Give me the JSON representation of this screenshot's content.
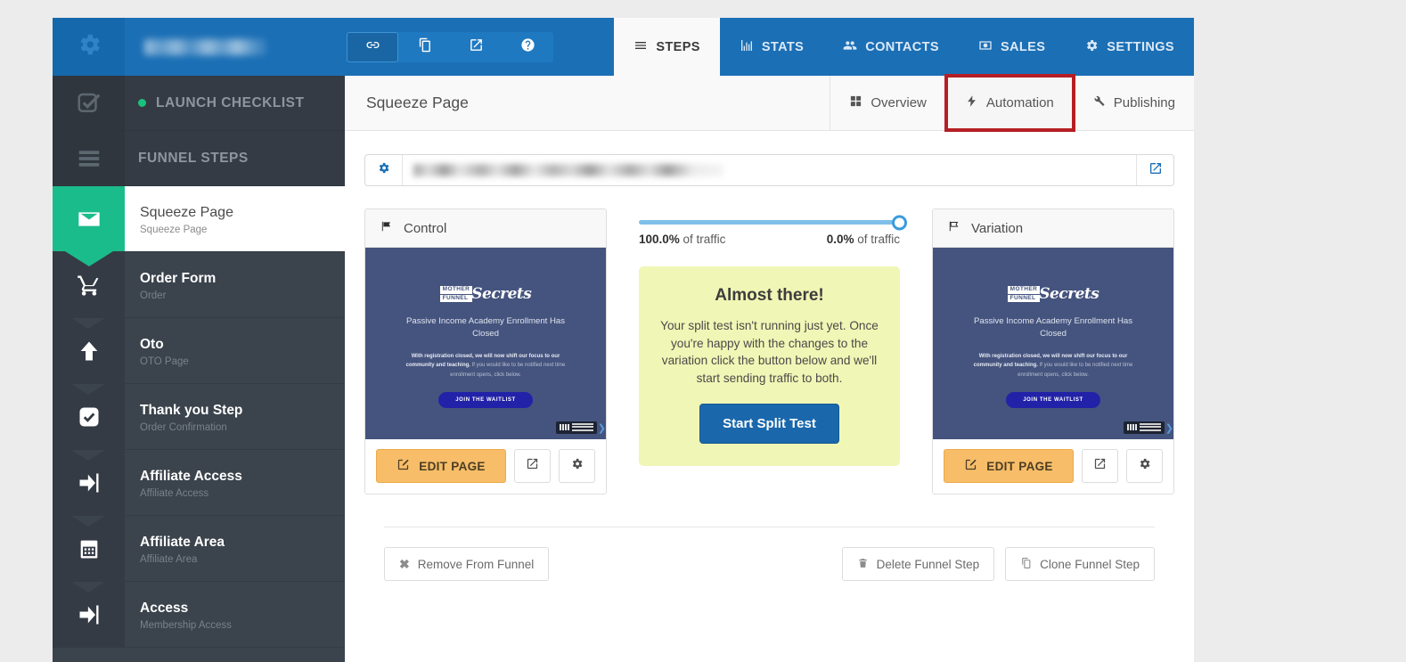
{
  "topbar": {
    "gear_icon": "gear-icon",
    "account_title_redacted": "",
    "quick_icons": [
      {
        "name": "link-icon",
        "label": "Link",
        "active": true
      },
      {
        "name": "copy-icon",
        "label": "Clone",
        "active": false
      },
      {
        "name": "external-link-icon",
        "label": "Open",
        "active": false
      },
      {
        "name": "help-circle-icon",
        "label": "Help",
        "active": false
      }
    ],
    "tabs": [
      {
        "label": "STEPS",
        "icon": "hamburger-icon",
        "active": true
      },
      {
        "label": "STATS",
        "icon": "bar-chart-icon",
        "active": false
      },
      {
        "label": "CONTACTS",
        "icon": "users-icon",
        "active": false
      },
      {
        "label": "SALES",
        "icon": "money-icon",
        "active": false
      },
      {
        "label": "SETTINGS",
        "icon": "gear-icon",
        "active": false
      }
    ]
  },
  "sidebar": {
    "launch_checklist": {
      "label": "LAUNCH CHECKLIST",
      "icon": "checkbox-outline-icon",
      "status_dot_color": "#19c27c"
    },
    "funnel_steps": {
      "label": "FUNNEL STEPS",
      "icon": "hamburger-icon"
    },
    "steps": [
      {
        "title": "Squeeze Page",
        "subtitle": "Squeeze Page",
        "icon": "envelope-icon",
        "active": true
      },
      {
        "title": "Order Form",
        "subtitle": "Order",
        "icon": "cart-icon",
        "active": false
      },
      {
        "title": "Oto",
        "subtitle": "OTO Page",
        "icon": "arrow-up-icon",
        "active": false
      },
      {
        "title": "Thank you Step",
        "subtitle": "Order Confirmation",
        "icon": "check-square-icon",
        "active": false
      },
      {
        "title": "Affiliate Access",
        "subtitle": "Affiliate Access",
        "icon": "sign-in-icon",
        "active": false
      },
      {
        "title": "Affiliate Area",
        "subtitle": "Affiliate Area",
        "icon": "calendar-icon",
        "active": false
      },
      {
        "title": "Access",
        "subtitle": "Membership Access",
        "icon": "sign-in-icon",
        "active": false
      }
    ]
  },
  "content": {
    "page_title": "Squeeze Page",
    "sub_tabs": [
      {
        "label": "Overview",
        "icon": "grid-icon",
        "highlighted": false
      },
      {
        "label": "Automation",
        "icon": "bolt-icon",
        "highlighted": true
      },
      {
        "label": "Publishing",
        "icon": "wrench-icon",
        "highlighted": false
      }
    ],
    "highlight_color": "#b51f24",
    "urlbar": {
      "gear_icon": "gear-icon",
      "url_redacted": "",
      "open_icon": "external-link-icon"
    },
    "split_test": {
      "control": {
        "header": "Control",
        "flag_icon": "flag-solid-icon",
        "preview": {
          "logo_line1": "MOTHER",
          "logo_line2": "FUNNEL",
          "logo_script": "Secrets",
          "headline": "Passive Income Academy Enrollment Has Closed",
          "body_bold": "With registration closed, we will now shift our focus to our community and teaching.",
          "body_rest": "If you would like to be notified next time enrollment opens, click below.",
          "cta": "JOIN THE WAITLIST",
          "badge": "clickfunnels-badge"
        },
        "edit_label": "EDIT PAGE",
        "edit_icon": "edit-pencil-icon",
        "open_icon": "external-link-icon",
        "settings_icon": "gear-icon"
      },
      "variation": {
        "header": "Variation",
        "flag_icon": "flag-outline-icon",
        "preview": {
          "logo_line1": "MOTHER",
          "logo_line2": "FUNNEL",
          "logo_script": "Secrets",
          "headline": "Passive Income Academy Enrollment Has Closed",
          "body_bold": "With registration closed, we will now shift our focus to our community and teaching.",
          "body_rest": "If you would like to be notified next time enrollment opens, click below.",
          "cta": "JOIN THE WAITLIST",
          "badge": "clickfunnels-badge"
        },
        "edit_label": "EDIT PAGE",
        "edit_icon": "edit-pencil-icon",
        "open_icon": "external-link-icon",
        "settings_icon": "gear-icon"
      },
      "traffic": {
        "left_percent": "100.0%",
        "left_suffix": " of traffic",
        "right_percent": "0.0%",
        "right_suffix": " of traffic",
        "slider_value": 100,
        "slider_color": "#7fc0ea",
        "knob_color": "#3c9bdb"
      },
      "notice": {
        "heading": "Almost there!",
        "text": "Your split test isn't running just yet. Once you're happy with the changes to the variation click the button below and we'll start sending traffic to both.",
        "button_label": "Start Split Test",
        "background": "#f0f6b5",
        "button_color": "#1a68ab"
      }
    },
    "footer_actions": {
      "remove": {
        "label": "Remove From Funnel",
        "icon": "x-icon"
      },
      "delete": {
        "label": "Delete Funnel Step",
        "icon": "trash-icon"
      },
      "clone": {
        "label": "Clone Funnel Step",
        "icon": "copy-icon"
      }
    }
  }
}
